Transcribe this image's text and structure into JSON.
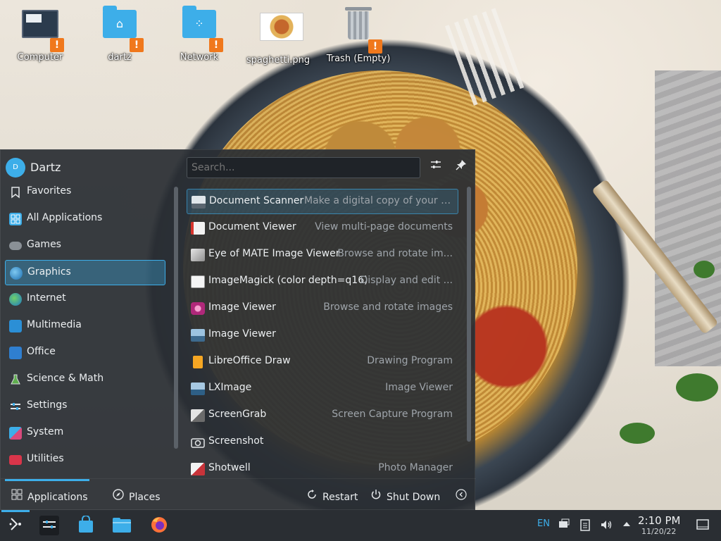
{
  "desktop": {
    "icons": [
      {
        "label": "Computer",
        "icon": "computer-icon",
        "badge": "!"
      },
      {
        "label": "dartz",
        "icon": "home-folder-icon",
        "badge": "!"
      },
      {
        "label": "Network",
        "icon": "network-folder-icon",
        "badge": "!"
      },
      {
        "label": "spaghetti.png",
        "icon": "image-file-icon"
      },
      {
        "label": "Trash (Empty)",
        "icon": "trash-icon",
        "badge": "!"
      }
    ]
  },
  "launcher": {
    "avatar_initial": "D",
    "username": "Dartz",
    "search_placeholder": "Search...",
    "categories": [
      {
        "label": "Favorites",
        "icon": "bookmark-icon"
      },
      {
        "label": "All Applications",
        "icon": "grid-icon"
      },
      {
        "label": "Games",
        "icon": "gamepad-icon"
      },
      {
        "label": "Graphics",
        "icon": "graphics-icon",
        "selected": true
      },
      {
        "label": "Internet",
        "icon": "globe-icon"
      },
      {
        "label": "Multimedia",
        "icon": "multimedia-icon"
      },
      {
        "label": "Office",
        "icon": "office-icon"
      },
      {
        "label": "Science & Math",
        "icon": "flask-icon"
      },
      {
        "label": "Settings",
        "icon": "settings-icon"
      },
      {
        "label": "System",
        "icon": "system-icon"
      },
      {
        "label": "Utilities",
        "icon": "utilities-icon"
      }
    ],
    "apps": [
      {
        "name": "Document Scanner",
        "desc": "Make a digital copy of your p...",
        "icon": "scanner-icon"
      },
      {
        "name": "Document Viewer",
        "desc": "View multi-page documents",
        "icon": "document-viewer-icon"
      },
      {
        "name": "Eye of MATE Image Viewer",
        "desc": "Browse and rotate im...",
        "icon": "eom-icon"
      },
      {
        "name": "ImageMagick (color depth=q16)",
        "desc": "Display and edit ...",
        "icon": "imagemagick-icon"
      },
      {
        "name": "Image Viewer",
        "desc": "Browse and rotate images",
        "icon": "image-viewer-icon"
      },
      {
        "name": "Image Viewer",
        "desc": "",
        "icon": "image-viewer-icon"
      },
      {
        "name": "LibreOffice Draw",
        "desc": "Drawing Program",
        "icon": "libreoffice-draw-icon"
      },
      {
        "name": "LXImage",
        "desc": "Image Viewer",
        "icon": "lximage-icon"
      },
      {
        "name": "ScreenGrab",
        "desc": "Screen Capture Program",
        "icon": "screengrab-icon"
      },
      {
        "name": "Screenshot",
        "desc": "",
        "icon": "camera-icon"
      },
      {
        "name": "Shotwell",
        "desc": "Photo Manager",
        "icon": "shotwell-icon"
      }
    ],
    "footer": {
      "applications": "Applications",
      "places": "Places",
      "restart": "Restart",
      "shutdown": "Shut Down"
    }
  },
  "taskbar": {
    "language": "EN",
    "time": "2:10 PM",
    "date": "11/20/22"
  },
  "colors": {
    "accent": "#3daee9",
    "panel": "#2a2e33",
    "warning_badge": "#f0781c"
  }
}
